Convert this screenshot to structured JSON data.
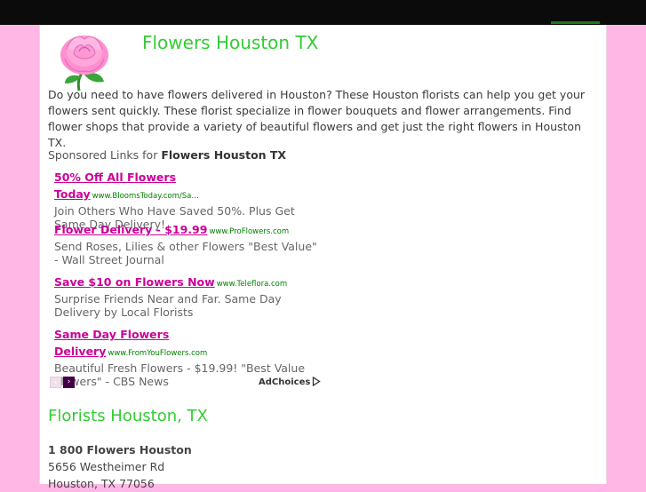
{
  "header": {
    "title": "Flowers Houston TX"
  },
  "intro": "Do you need to have flowers delivered in Houston? These Houston florists can help you get your flowers sent quickly. These florist specialize in flower bouquets and flower arrangements. Find flower shops that provide a variety of beautiful flowers and get just the right flowers in Houston TX.",
  "sponsored": {
    "prefix": "Sponsored Links for ",
    "keyword": "Flowers Houston TX"
  },
  "ads": [
    {
      "title": "50% Off All Flowers Today",
      "url": "www.BloomsToday.com/Sa…",
      "desc": "Join Others Who Have Saved 50%. Plus Get Same Day Delivery!"
    },
    {
      "title": "Flower Delivery - $19.99",
      "url": "www.ProFlowers.com",
      "desc": "Send Roses, Lilies & other Flowers \"Best Value\" - Wall Street Journal"
    },
    {
      "title": "Save $10 on Flowers Now",
      "url": "www.Teleflora.com",
      "desc": "Surprise Friends Near and Far. Same Day Delivery by Local Florists"
    },
    {
      "title": "Same Day Flowers Delivery",
      "url": "www.FromYouFlowers.com",
      "desc": "Beautiful Fresh Flowers - $19.99! \"Best Value Flowers\" - CBS News"
    }
  ],
  "pager": {
    "prev_icon": "chevron-left-icon",
    "next_icon": "chevron-right-icon",
    "prev_glyph": "‹",
    "next_glyph": "›"
  },
  "adchoices_label": "AdChoices",
  "florists": {
    "heading": "Florists Houston, TX",
    "listing": {
      "name": "1 800 Flowers Houston",
      "street": "5656 Westheimer Rd",
      "city": "Houston, TX 77056"
    }
  },
  "colors": {
    "background": "#ffb8e6",
    "topbar": "#0b0b0b",
    "title_green": "#33cc33",
    "ad_link": "#cc0099",
    "ad_url": "#008000"
  }
}
